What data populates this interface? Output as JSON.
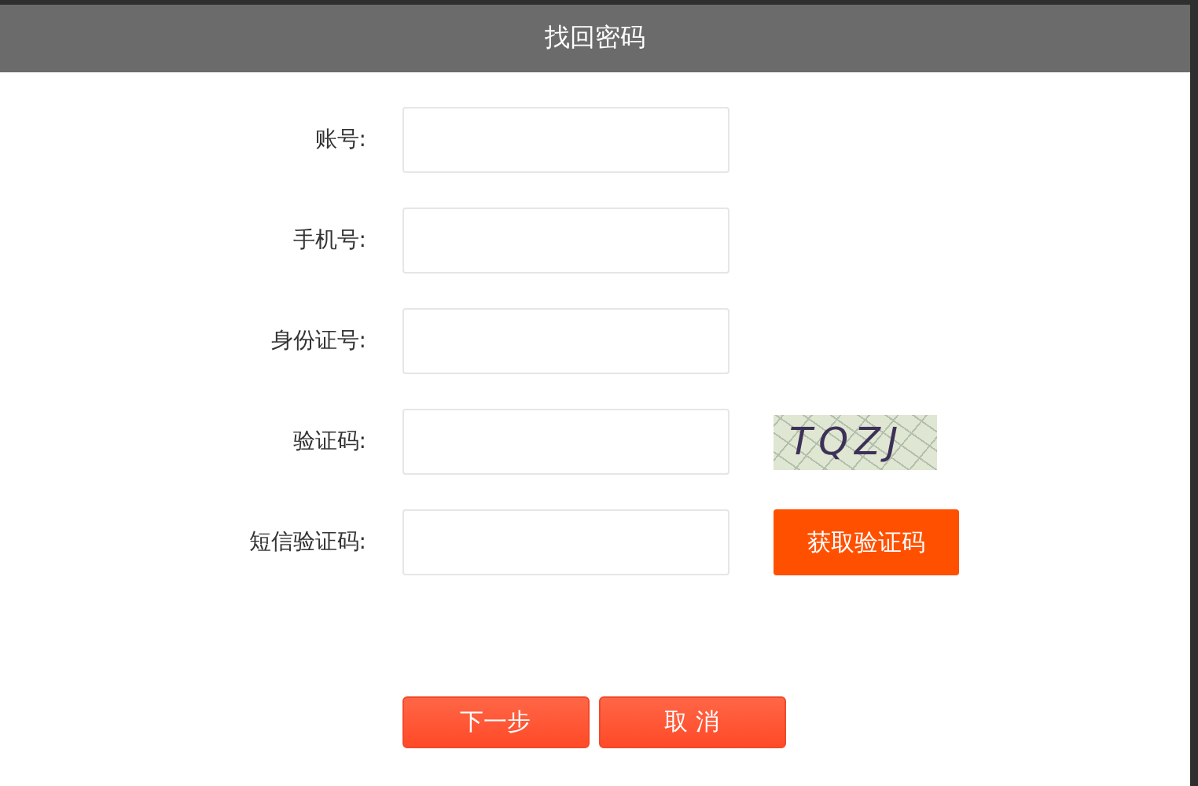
{
  "dialog": {
    "title": "找回密码"
  },
  "fields": [
    {
      "label": "账号:",
      "kind": "input"
    },
    {
      "label": "手机号:",
      "kind": "input"
    },
    {
      "label": "身份证号:",
      "kind": "input"
    },
    {
      "label": "验证码:",
      "kind": "captcha",
      "captcha": "TQZJ"
    },
    {
      "label": "短信验证码:",
      "kind": "sms",
      "button": "获取验证码"
    }
  ],
  "buttons": [
    "下一步",
    "取 消"
  ]
}
